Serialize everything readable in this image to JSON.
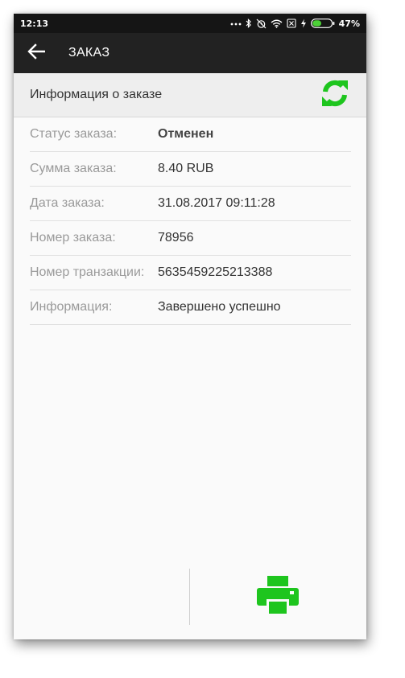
{
  "status_bar": {
    "time": "12:13",
    "battery_percent": "47%",
    "battery_level": 0.47,
    "icons": [
      "more-dots-icon",
      "bluetooth-icon",
      "alarm-off-icon",
      "wifi-icon",
      "sim-off-icon",
      "charging-icon",
      "battery-icon"
    ]
  },
  "app_bar": {
    "title": "ЗАКАЗ",
    "back_icon": "arrow-left-icon"
  },
  "section": {
    "title": "Информация о заказе",
    "refresh_icon": "refresh-icon"
  },
  "order": {
    "rows": [
      {
        "label": "Статус заказа:",
        "value": "Отменен"
      },
      {
        "label": "Сумма заказа:",
        "value": "8.40 RUB"
      },
      {
        "label": "Дата заказа:",
        "value": "31.08.2017 09:11:28"
      },
      {
        "label": "Номер заказа:",
        "value": "78956"
      },
      {
        "label": "Номер транзакции:",
        "value": "5635459225213388"
      },
      {
        "label": "Информация:",
        "value": "Завершено успешно"
      }
    ]
  },
  "footer": {
    "print_icon": "printer-icon"
  },
  "colors": {
    "accent_green": "#1ec51e",
    "app_bar": "#222222",
    "status_bar": "#151515",
    "battery_green": "#4cd137"
  }
}
